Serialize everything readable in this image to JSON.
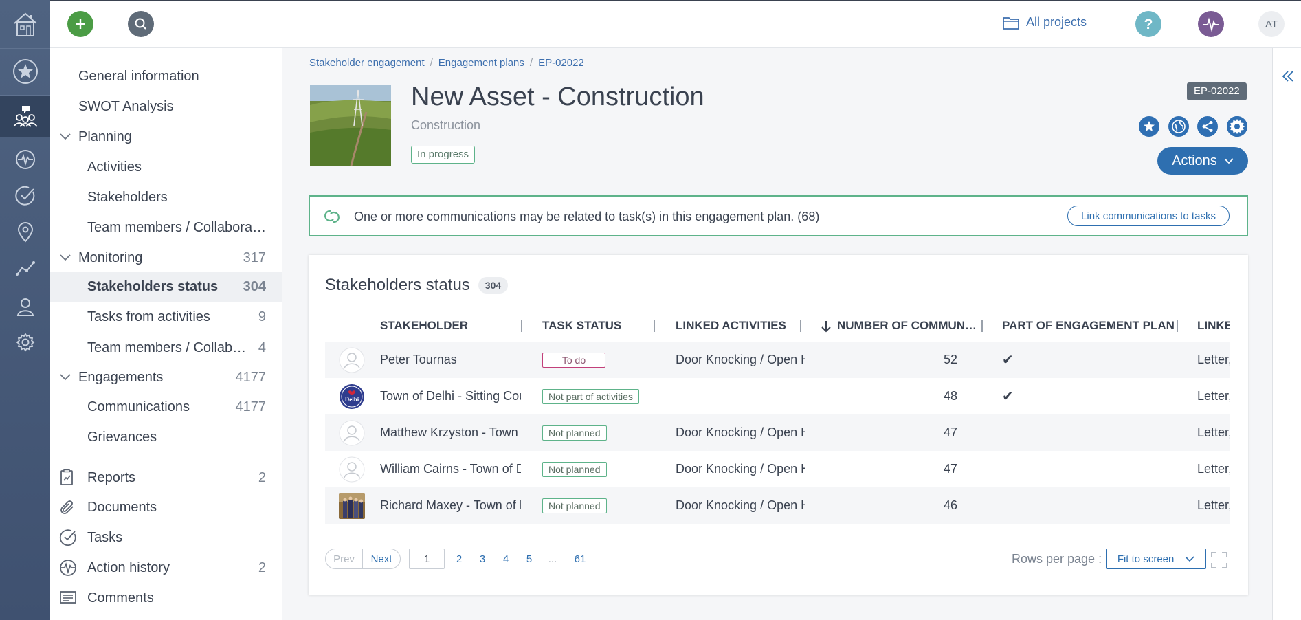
{
  "topbar": {
    "all_projects": "All projects",
    "user_initials": "AT",
    "colors": {
      "add": "#4b9c45",
      "search": "#5f6b78",
      "help": "#6fb7c6",
      "activity": "#7a5b94"
    }
  },
  "nav": {
    "items": [
      {
        "label": "General information",
        "count": ""
      },
      {
        "label": "SWOT Analysis",
        "count": ""
      },
      {
        "label": "Planning",
        "count": ""
      },
      {
        "label": "Activities",
        "count": ""
      },
      {
        "label": "Stakeholders",
        "count": ""
      },
      {
        "label": "Team members / Collaborat…",
        "count": ""
      },
      {
        "label": "Monitoring",
        "count": "317"
      },
      {
        "label": "Stakeholders status",
        "count": "304"
      },
      {
        "label": "Tasks from activities",
        "count": "9"
      },
      {
        "label": "Team members / Collab…",
        "count": "4"
      },
      {
        "label": "Engagements",
        "count": "4177"
      },
      {
        "label": "Communications",
        "count": "4177"
      },
      {
        "label": "Grievances",
        "count": ""
      },
      {
        "label": "Reports",
        "count": "2"
      },
      {
        "label": "Documents",
        "count": ""
      },
      {
        "label": "Tasks",
        "count": ""
      },
      {
        "label": "Action history",
        "count": "2"
      },
      {
        "label": "Comments",
        "count": ""
      }
    ]
  },
  "breadcrumb": [
    "Stakeholder engagement",
    "Engagement plans",
    "EP-02022"
  ],
  "header": {
    "title": "New Asset - Construction",
    "subtitle": "Construction",
    "status": "In progress",
    "code": "EP-02022",
    "actions_label": "Actions"
  },
  "notice": {
    "text": "One or more communications may be related to task(s) in this engagement plan. (68)",
    "button": "Link communications to tasks"
  },
  "table": {
    "title": "Stakeholders status",
    "count": "304",
    "columns": [
      "STAKEHOLDER",
      "TASK STATUS",
      "LINKED ACTIVITIES",
      "NUMBER OF COMMUN…",
      "PART OF ENGAGEMENT PLAN",
      "LINKE"
    ],
    "rows": [
      {
        "stakeholder": "Peter Tournas",
        "task_status": "To do",
        "activities": "Door Knocking / Open H",
        "number": "52",
        "part": "✔",
        "linked": "Letter,/"
      },
      {
        "stakeholder": "Town of Delhi - Sitting Coun",
        "task_status": "Not part of activities",
        "activities": "",
        "number": "48",
        "part": "✔",
        "linked": "Letter,/"
      },
      {
        "stakeholder": "Matthew Krzyston - Town o",
        "task_status": "Not planned",
        "activities": "Door Knocking / Open H",
        "number": "47",
        "part": "",
        "linked": "Letter,/"
      },
      {
        "stakeholder": "William Cairns - Town of De",
        "task_status": "Not planned",
        "activities": "Door Knocking / Open H",
        "number": "47",
        "part": "",
        "linked": "Letter,/"
      },
      {
        "stakeholder": "Richard Maxey - Town of De",
        "task_status": "Not planned",
        "activities": "Door Knocking / Open H",
        "number": "46",
        "part": "",
        "linked": "Letter,/"
      }
    ],
    "delhi_logo_text": "Delhi"
  },
  "pager": {
    "prev": "Prev",
    "next": "Next",
    "current": "1",
    "pages": [
      "2",
      "3",
      "4",
      "5",
      "...",
      "61"
    ],
    "rows_per_page_label": "Rows per page :",
    "rows_per_page_value": "Fit to screen"
  }
}
